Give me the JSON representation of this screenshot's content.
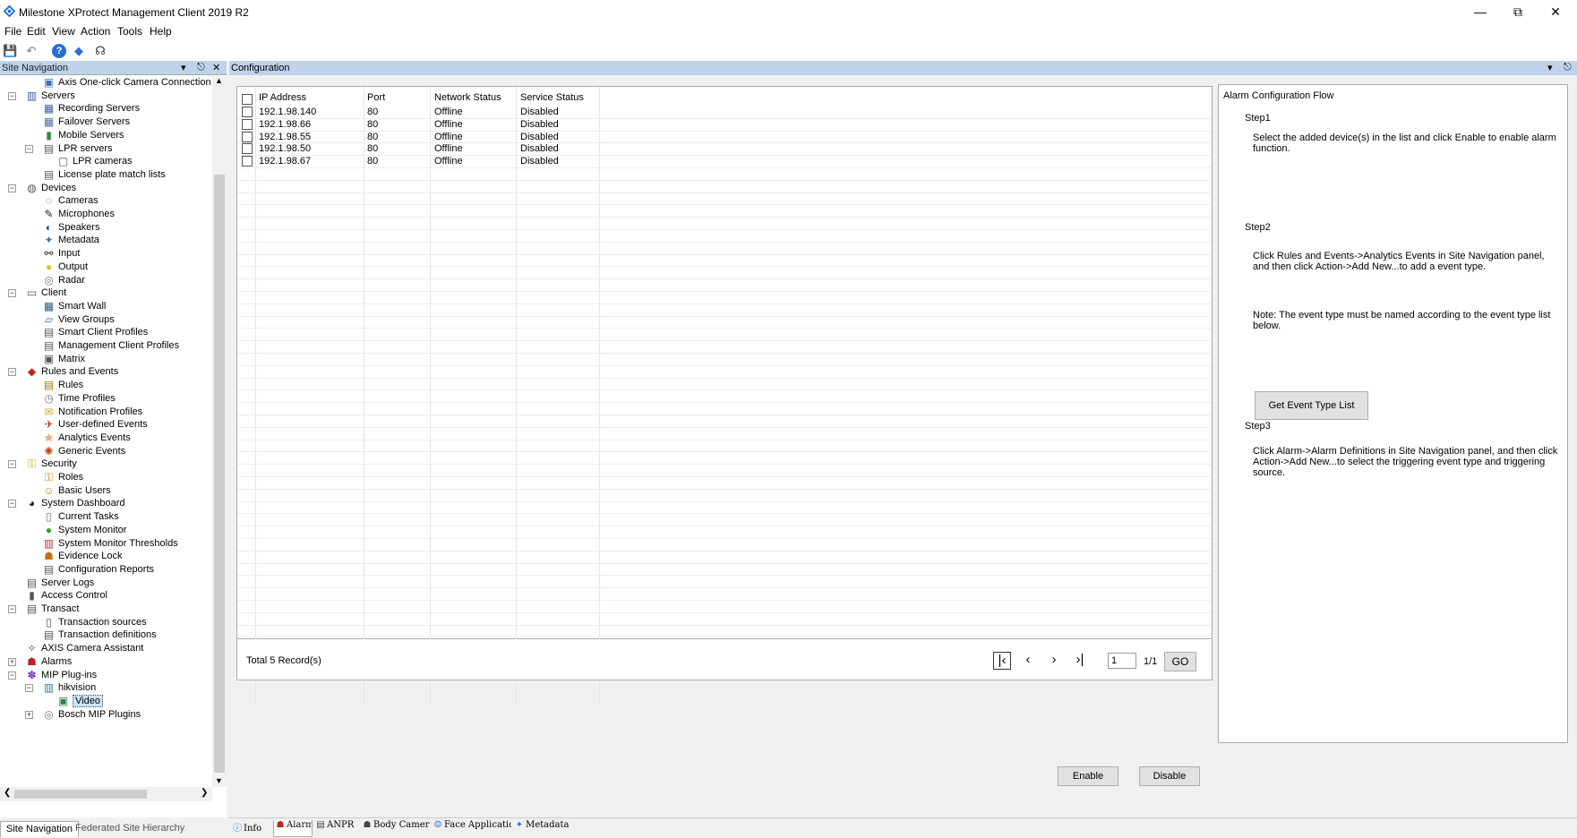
{
  "window": {
    "title": "Milestone XProtect Management Client 2019 R2"
  },
  "menu": {
    "items": [
      "File",
      "Edit",
      "View",
      "Action",
      "Tools",
      "Help"
    ]
  },
  "nav": {
    "header": "Site Navigation",
    "tree": [
      {
        "label": "Axis One-click Camera Connection",
        "icon": "axis-icon",
        "level": 2
      },
      {
        "label": "Servers",
        "icon": "servers-icon",
        "level": 1,
        "expander": "−"
      },
      {
        "label": "Recording Servers",
        "icon": "recording-server-icon",
        "level": 2
      },
      {
        "label": "Failover Servers",
        "icon": "failover-server-icon",
        "level": 2
      },
      {
        "label": "Mobile Servers",
        "icon": "mobile-server-icon",
        "level": 2
      },
      {
        "label": "LPR servers",
        "icon": "lpr-server-icon",
        "level": 2,
        "expander": "−"
      },
      {
        "label": "LPR cameras",
        "icon": "lpr-camera-icon",
        "level": 3
      },
      {
        "label": "License plate match lists",
        "icon": "list-icon",
        "level": 2
      },
      {
        "label": "Devices",
        "icon": "devices-icon",
        "level": 1,
        "expander": "−"
      },
      {
        "label": "Cameras",
        "icon": "camera-icon",
        "level": 2
      },
      {
        "label": "Microphones",
        "icon": "microphone-icon",
        "level": 2
      },
      {
        "label": "Speakers",
        "icon": "speaker-icon",
        "level": 2
      },
      {
        "label": "Metadata",
        "icon": "metadata-icon",
        "level": 2
      },
      {
        "label": "Input",
        "icon": "input-icon",
        "level": 2
      },
      {
        "label": "Output",
        "icon": "output-icon",
        "level": 2
      },
      {
        "label": "Radar",
        "icon": "radar-icon",
        "level": 2
      },
      {
        "label": "Client",
        "icon": "client-icon",
        "level": 1,
        "expander": "−"
      },
      {
        "label": "Smart Wall",
        "icon": "smart-wall-icon",
        "level": 2
      },
      {
        "label": "View Groups",
        "icon": "view-groups-icon",
        "level": 2
      },
      {
        "label": "Smart Client Profiles",
        "icon": "profile-icon",
        "level": 2
      },
      {
        "label": "Management Client Profiles",
        "icon": "profile-icon",
        "level": 2
      },
      {
        "label": "Matrix",
        "icon": "matrix-icon",
        "level": 2
      },
      {
        "label": "Rules and Events",
        "icon": "rules-events-icon",
        "level": 1,
        "expander": "−"
      },
      {
        "label": "Rules",
        "icon": "rules-icon",
        "level": 2
      },
      {
        "label": "Time Profiles",
        "icon": "clock-icon",
        "level": 2
      },
      {
        "label": "Notification Profiles",
        "icon": "envelope-icon",
        "level": 2
      },
      {
        "label": "User-defined Events",
        "icon": "event-icon",
        "level": 2
      },
      {
        "label": "Analytics Events",
        "icon": "analytics-icon",
        "level": 2
      },
      {
        "label": "Generic Events",
        "icon": "generic-event-icon",
        "level": 2
      },
      {
        "label": "Security",
        "icon": "security-icon",
        "level": 1,
        "expander": "−"
      },
      {
        "label": "Roles",
        "icon": "roles-icon",
        "level": 2
      },
      {
        "label": "Basic Users",
        "icon": "user-icon",
        "level": 2
      },
      {
        "label": "System Dashboard",
        "icon": "dashboard-icon",
        "level": 1,
        "expander": "−"
      },
      {
        "label": "Current Tasks",
        "icon": "tasks-icon",
        "level": 2
      },
      {
        "label": "System Monitor",
        "icon": "monitor-icon",
        "level": 2
      },
      {
        "label": "System Monitor Thresholds",
        "icon": "thresholds-icon",
        "level": 2
      },
      {
        "label": "Evidence Lock",
        "icon": "lock-icon",
        "level": 2
      },
      {
        "label": "Configuration Reports",
        "icon": "report-icon",
        "level": 2
      },
      {
        "label": "Server Logs",
        "icon": "logs-icon",
        "level": 1
      },
      {
        "label": "Access Control",
        "icon": "access-control-icon",
        "level": 1
      },
      {
        "label": "Transact",
        "icon": "transact-icon",
        "level": 1,
        "expander": "−"
      },
      {
        "label": "Transaction sources",
        "icon": "transaction-source-icon",
        "level": 2
      },
      {
        "label": "Transaction definitions",
        "icon": "transaction-def-icon",
        "level": 2
      },
      {
        "label": "AXIS Camera Assistant",
        "icon": "axis-assistant-icon",
        "level": 1
      },
      {
        "label": "Alarms",
        "icon": "alarm-icon",
        "level": 1,
        "expander": "+"
      },
      {
        "label": "MIP Plug-ins",
        "icon": "plugin-icon",
        "level": 1,
        "expander": "−"
      },
      {
        "label": "hikvision",
        "icon": "hikvision-icon",
        "level": 2,
        "expander": "−"
      },
      {
        "label": "Video",
        "icon": "video-icon",
        "level": 3,
        "selected": true
      },
      {
        "label": "Bosch MIP Plugins",
        "icon": "bosch-icon",
        "level": 2,
        "expander": "+"
      }
    ],
    "tabs": [
      "Site Navigation",
      "Federated Site Hierarchy"
    ]
  },
  "config": {
    "header": "Configuration",
    "columns": [
      "IP Address",
      "Port",
      "Network Status",
      "Service Status"
    ],
    "rows": [
      {
        "ip": "192.1.98.140",
        "port": "80",
        "network": "Offline",
        "service": "Disabled"
      },
      {
        "ip": "192.1.98.66",
        "port": "80",
        "network": "Offline",
        "service": "Disabled"
      },
      {
        "ip": "192.1.98.55",
        "port": "80",
        "network": "Offline",
        "service": "Disabled"
      },
      {
        "ip": "192.1.98.50",
        "port": "80",
        "network": "Offline",
        "service": "Disabled"
      },
      {
        "ip": "192.1.98.67",
        "port": "80",
        "network": "Offline",
        "service": "Disabled"
      }
    ],
    "total": "Total 5 Record(s)",
    "page_input": "1",
    "page_count": "1/1",
    "go_label": "GO",
    "enable_label": "Enable",
    "disable_label": "Disable"
  },
  "flow": {
    "title": "Alarm Configuration Flow",
    "step1": "Step1",
    "step1_text": "Select the added device(s) in the list and click Enable to enable alarm function.",
    "step2": "Step2",
    "step2_text": "Click Rules and Events->Analytics Events in Site Navigation panel, and then click Action->Add New...to add a event type.",
    "note": "Note: The event type  must be named according to the event type list below.",
    "event_button": "Get Event Type List",
    "step3": "Step3",
    "step3_text": "Click Alarm->Alarm Definitions in Site Navigation panel, and then click Action->Add New...to select the triggering event type and triggering source."
  },
  "bottom_tabs": [
    {
      "label": "Info",
      "icon": "info-icon"
    },
    {
      "label": "Alarm",
      "icon": "alarm-icon",
      "active": true
    },
    {
      "label": "ANPR",
      "icon": "anpr-icon"
    },
    {
      "label": "Body Camera",
      "icon": "body-camera-icon"
    },
    {
      "label": "Face Application",
      "icon": "face-icon"
    },
    {
      "label": "Metadata",
      "icon": "metadata-icon"
    }
  ],
  "colors": {
    "pane_header": "#bfd2ea",
    "selected": "#cce4f7",
    "accent": "#1e6fd9"
  }
}
